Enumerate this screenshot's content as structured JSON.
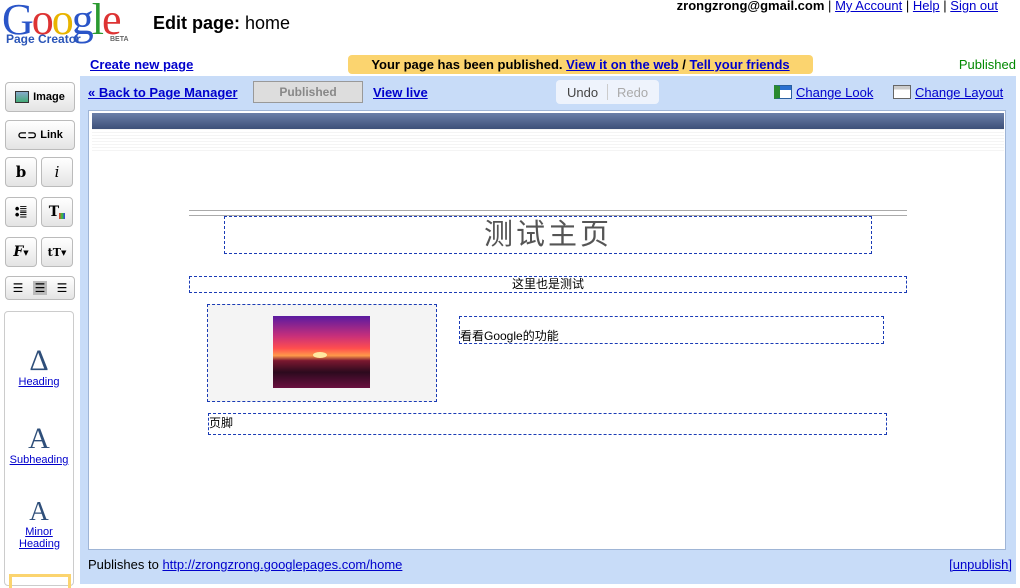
{
  "logo": {
    "wordmark": "Google",
    "product": "Page Creator",
    "badge": "BETA"
  },
  "title": {
    "prefix": "Edit page:",
    "page": "home"
  },
  "account": {
    "email": "zrongzrong@gmail.com",
    "sep": "|",
    "my_account": "My Account",
    "help": "Help",
    "sign_out": "Sign out"
  },
  "create_new_page": "Create new page",
  "banner": {
    "text": "Your page has been published.",
    "view_link": "View it on the web",
    "slash": "/",
    "tell_link": "Tell your friends"
  },
  "status": "Published",
  "toolbar": {
    "back": "« Back to Page Manager",
    "published_button": "Published",
    "view_live": "View live",
    "undo": "Undo",
    "redo": "Redo",
    "change_look": "Change Look",
    "change_layout": "Change Layout"
  },
  "left_tools": {
    "image": "Image",
    "link": "Link",
    "bold": "b",
    "italic": "i",
    "text_color": "T",
    "font": "F",
    "font_size": "tT"
  },
  "palette": [
    {
      "glyph": "Δ",
      "label": "Heading"
    },
    {
      "glyph": "A",
      "label": "Subheading"
    },
    {
      "glyph": "A",
      "label": "Minor Heading"
    }
  ],
  "content": {
    "title": "测试主页",
    "subtitle": "这里也是测试",
    "feature_text": "看看Google的功能",
    "footer": "页脚"
  },
  "bottom": {
    "publishes_to": "Publishes to",
    "url": "http://zrongzrong.googlepages.com/home",
    "unpublish": "[unpublish]"
  },
  "colors": {
    "banner": "#fbd46f",
    "frame": "#c8dcf8",
    "header_bar": "#3d5078",
    "published": "#008800",
    "link": "#0000cc"
  }
}
